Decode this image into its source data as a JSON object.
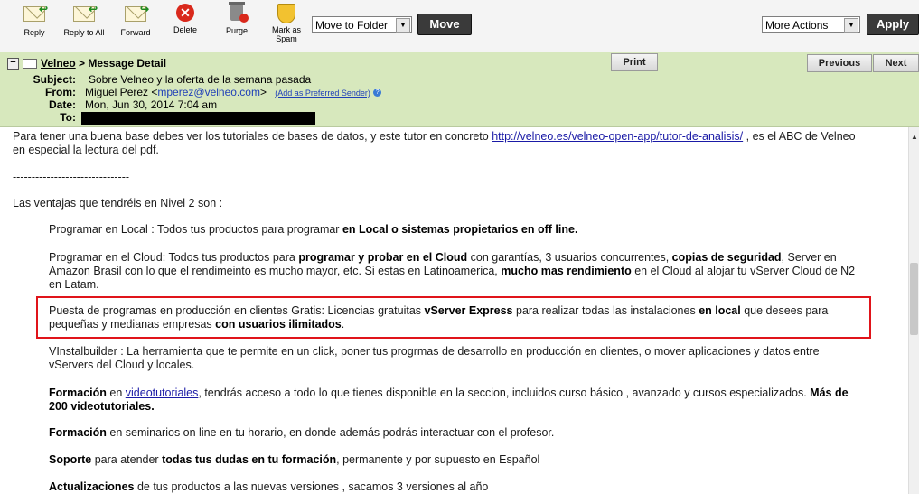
{
  "toolbar": {
    "reply": "Reply",
    "reply_all": "Reply to All",
    "forward": "Forward",
    "delete": "Delete",
    "purge": "Purge",
    "spam_line1": "Mark as",
    "spam_line2": "Spam",
    "folder_select": "Move to Folder",
    "move": "Move",
    "actions_select": "More Actions",
    "apply": "Apply"
  },
  "header": {
    "breadcrumb_link": "Velneo",
    "breadcrumb_rest": " > Message Detail",
    "print": "Print",
    "previous": "Previous",
    "next": "Next",
    "subject_label": "Subject:",
    "subject": "Sobre Velneo y la oferta de la semana pasada",
    "from_label": "From:",
    "from_name": "Miguel Perez <",
    "from_email": "mperez@velneo.com",
    "from_close": ">",
    "add_sender": "(Add as Preferred Sender)",
    "date_label": "Date:",
    "date": "Mon, Jun 30, 2014 7:04 am",
    "to_label": "To:"
  },
  "body": {
    "p1_a": "Para tener una buena base debes ver  los tutoriales de bases de datos, y este tutor en concreto ",
    "p1_link": "http://velneo.es/velneo-open-app/tutor-de-analisis/",
    "p1_b": " , es el ABC de Velneo",
    "p1_c": "en especial la lectura del pdf.",
    "divider": "-------------------------------",
    "intro": "Las ventajas que tendréis en Nivel 2 son :",
    "local_a": "Programar en Local : Todos tus productos para programar ",
    "local_b": "en Local o sistemas propietarios en off line.",
    "cloud_a": "Programar en el Cloud: Todos tus productos para ",
    "cloud_b": "programar y probar en el Cloud",
    "cloud_c": " con garantías, 3 usuarios concurrentes, ",
    "cloud_d": "copias de seguridad",
    "cloud_e": ", Server en",
    "cloud_f": "Amazon Brasil con lo que el rendimeinto es mucho mayor, etc. Si estas en Latinoamerica, ",
    "cloud_g": "mucho mas rendimiento",
    "cloud_h": " en el Cloud al  alojar tu vServer Cloud de N2",
    "cloud_i": "en Latam.",
    "prod_a": "Puesta de programas en producción en clientes Gratis: Licencias gratuitas ",
    "prod_b": "vServer Express",
    "prod_c": " para realizar todas las instalaciones ",
    "prod_d": "en local",
    "prod_e": " que desees para",
    "prod_f": "pequeñas y medianas empresas ",
    "prod_g": "con usuarios ilimitados",
    "prod_h": ".",
    "vi_a": "VInstalbuilder : La herramienta que te permite en un click, poner tus progrmas de desarrollo en producción en clientes, o mover aplicaciones y datos entre",
    "vi_b": "vServers del Cloud y locales.",
    "form_a": "Formación",
    "form_b": " en ",
    "form_link": "videotutoriales",
    "form_c": ",  tendrás acceso a todo lo que tienes disponible en la seccion, incluidos curso básico , avanzado y cursos especializados. ",
    "form_d": "Más de",
    "form_e": "200 videotutoriales.",
    "sem_a": "Formación",
    "sem_b": " en seminarios on line en tu horario, en donde además podrás interactuar con el profesor.",
    "sup_a": "Soporte",
    "sup_b": " para atender ",
    "sup_c": "todas tus dudas en tu formación",
    "sup_d": ", permanente y por supuesto en Español",
    "act_a": "Actualizaciones",
    "act_b": " de tus productos a las nuevas versiones , sacamos 3 versiones al año"
  }
}
